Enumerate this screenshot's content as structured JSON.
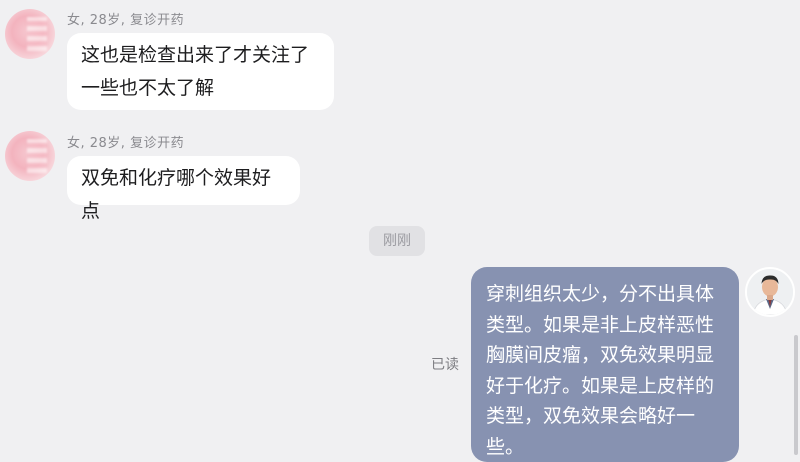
{
  "messages": [
    {
      "sender_meta": "女, 28岁, 复诊开药",
      "text_lines": [
        "这也是检查出来了才关注了",
        "一些也不太了解"
      ]
    },
    {
      "sender_meta": "女, 28岁, 复诊开药",
      "text_lines": [
        "双免和化疗哪个效果好点"
      ]
    }
  ],
  "timestamp": "刚刚",
  "reply": {
    "read_status": "已读",
    "text": "穿刺组织太少，分不出具体类型。如果是非上皮样恶性胸膜间皮瘤，双免效果明显好于化疗。如果是上皮样的类型，双免效果会略好一些。"
  },
  "colors": {
    "background": "#f0f0f2",
    "incoming_bubble": "#ffffff",
    "outgoing_bubble": "#8792b1",
    "meta_text": "#8a8a8f"
  },
  "icons": {
    "patient_avatar": "blurred-pink-avatar",
    "doctor_avatar": "doctor-portrait-avatar"
  }
}
